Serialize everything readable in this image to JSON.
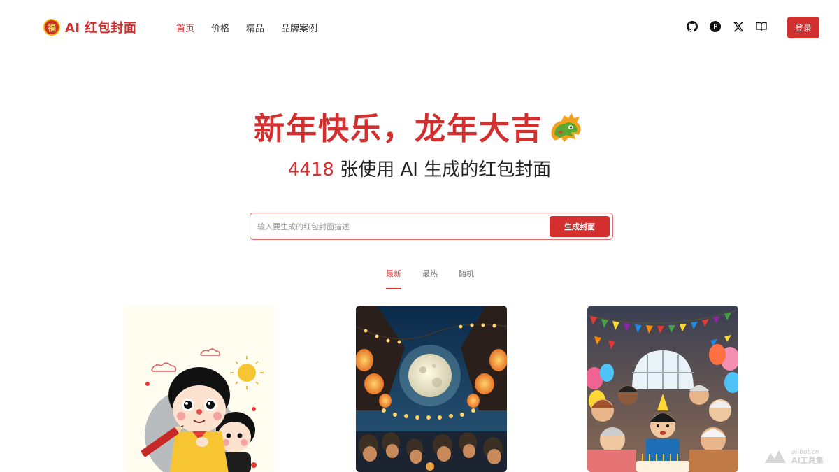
{
  "header": {
    "logo_text": "AI 红包封面",
    "logo_badge": "福",
    "nav": [
      {
        "label": "首页",
        "active": true
      },
      {
        "label": "价格",
        "active": false
      },
      {
        "label": "精品",
        "active": false
      },
      {
        "label": "品牌案例",
        "active": false
      }
    ],
    "icons": [
      "github-icon",
      "producthunt-icon",
      "x-icon",
      "book-icon"
    ],
    "login_label": "登录"
  },
  "hero": {
    "title": "新年快乐，龙年大吉",
    "count": "4418",
    "subtitle_rest": " 张使用 AI 生成的红包封面"
  },
  "search": {
    "placeholder": "输入要生成的红包封面描述",
    "button_label": "生成封面"
  },
  "tabs": [
    {
      "label": "最新",
      "active": true
    },
    {
      "label": "最热",
      "active": false
    },
    {
      "label": "随机",
      "active": false
    }
  ],
  "watermark": {
    "small": "ai-bot.cn",
    "big": "AI工具集"
  },
  "colors": {
    "accent": "#d32f2f",
    "text": "#222222"
  }
}
